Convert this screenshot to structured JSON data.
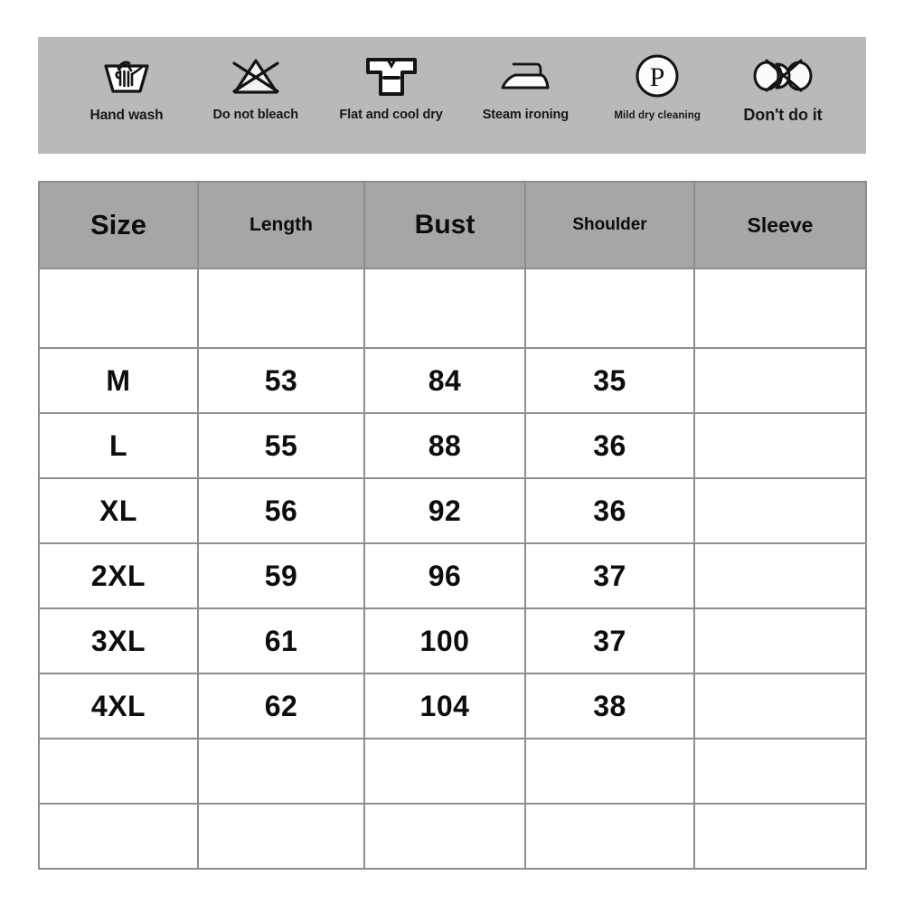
{
  "care_band": {
    "background_color": "#b9b9b9",
    "symbols": [
      {
        "icon": "hand-wash-icon",
        "label": "Hand wash"
      },
      {
        "icon": "do-not-bleach-icon",
        "label": "Do not bleach"
      },
      {
        "icon": "flat-dry-tshirt-icon",
        "label": "Flat and cool dry"
      },
      {
        "icon": "steam-iron-icon",
        "label": "Steam ironing"
      },
      {
        "icon": "mild-dry-clean-p-icon",
        "label": "Mild dry cleaning"
      },
      {
        "icon": "do-not-wring-icon",
        "label": "Don't do it"
      }
    ]
  },
  "size_table": {
    "header_color": "#a6a6a6",
    "border_color": "#8e8e8e",
    "columns": [
      "Size",
      "Length",
      "Bust",
      "Shoulder",
      "Sleeve"
    ],
    "rows": [
      {
        "size": "",
        "length": "",
        "bust": "",
        "shoulder": "",
        "sleeve": ""
      },
      {
        "size": "M",
        "length": "53",
        "bust": "84",
        "shoulder": "35",
        "sleeve": ""
      },
      {
        "size": "L",
        "length": "55",
        "bust": "88",
        "shoulder": "36",
        "sleeve": ""
      },
      {
        "size": "XL",
        "length": "56",
        "bust": "92",
        "shoulder": "36",
        "sleeve": ""
      },
      {
        "size": "2XL",
        "length": "59",
        "bust": "96",
        "shoulder": "37",
        "sleeve": ""
      },
      {
        "size": "3XL",
        "length": "61",
        "bust": "100",
        "shoulder": "37",
        "sleeve": ""
      },
      {
        "size": "4XL",
        "length": "62",
        "bust": "104",
        "shoulder": "38",
        "sleeve": ""
      },
      {
        "size": "",
        "length": "",
        "bust": "",
        "shoulder": "",
        "sleeve": ""
      },
      {
        "size": "",
        "length": "",
        "bust": "",
        "shoulder": "",
        "sleeve": ""
      }
    ]
  }
}
